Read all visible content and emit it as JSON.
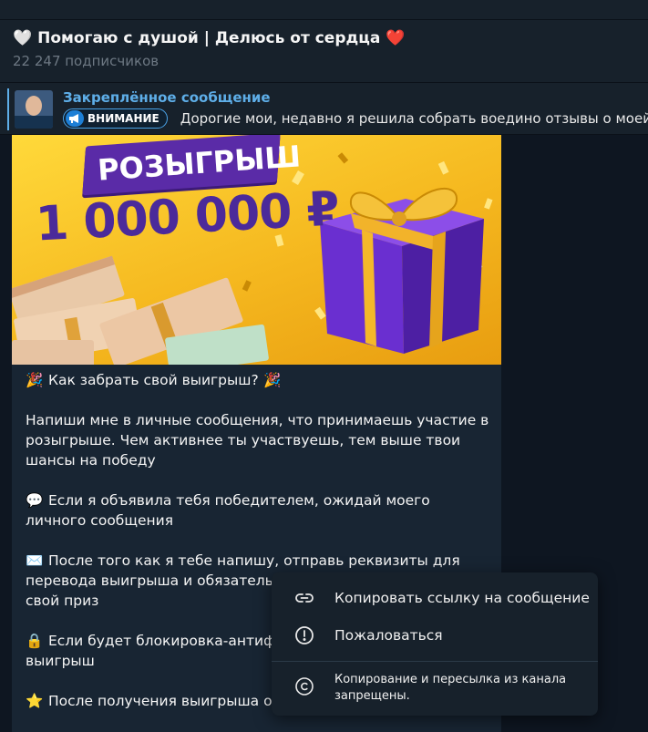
{
  "channel": {
    "title_prefix_icon": "white-heart-icon",
    "title": "Помогаю с душой | Делюсь от сердца",
    "title_suffix_icon": "red-heart-icon",
    "subscribers": "22 247 подписчиков"
  },
  "pinned": {
    "label": "Закреплённое сообщение",
    "badge_icon": "megaphone-icon",
    "badge_text": "ВНИМАНИЕ",
    "text": "Дорогие мои, недавно я решила собрать воедино отзывы о моей"
  },
  "post": {
    "image": {
      "banner_text": "РОЗЫГРЫШ",
      "amount_text": "1 000 000 ₽"
    },
    "paragraphs": [
      {
        "icon": "party-popper-icon",
        "emoji": "🎉",
        "text": "Как забрать свой выигрыш?",
        "emoji_after": "🎉"
      },
      {
        "icon": "",
        "emoji": "",
        "text": "Напиши мне в личные сообщения, что принимаешь участие в розыгрыше. Чем активнее ты участвуешь, тем выше твои шансы на победу",
        "emoji_after": ""
      },
      {
        "icon": "speech-bubble-icon",
        "emoji": "💬",
        "text": "Если я объявила тебя победителем, ожидай моего личного сообщения",
        "emoji_after": ""
      },
      {
        "icon": "envelope-icon",
        "emoji": "✉️",
        "text": "После того как я тебе напишу, отправь реквизиты для перевода выигрыша и обязательно планируешь потратить свой приз",
        "emoji_after": ""
      },
      {
        "icon": "lock-icon",
        "emoji": "🔒",
        "text": "Если будет блокировка-антифро сможешь получить свой выигрыш",
        "emoji_after": ""
      },
      {
        "icon": "star-icon",
        "emoji": "⭐",
        "text": "После получения выигрыша об получении приза",
        "emoji_after": ""
      }
    ]
  },
  "context_menu": {
    "items": [
      {
        "icon": "link-icon",
        "label": "Копировать ссылку на сообщение"
      },
      {
        "icon": "report-icon",
        "label": "Пожаловаться"
      }
    ],
    "note_icon": "copyright-icon",
    "note": "Копирование и пересылка из канала запрещены."
  }
}
